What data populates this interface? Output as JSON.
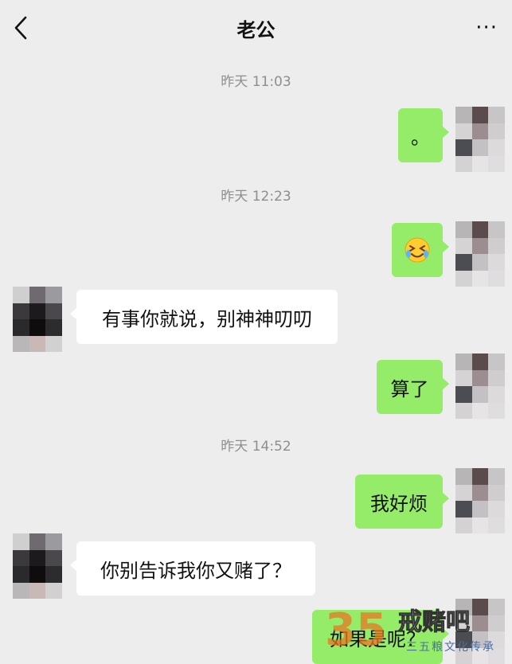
{
  "header": {
    "title": "老公",
    "more": "···"
  },
  "timestamps": [
    "昨天 11:03",
    "昨天 12:23",
    "昨天 14:52"
  ],
  "messages": [
    {
      "from": "me",
      "text": "。"
    },
    {
      "from": "me",
      "text": "😖",
      "emoji": "crying-squint-emoji"
    },
    {
      "from": "other",
      "text": "有事你就说，别神神叨叨"
    },
    {
      "from": "me",
      "text": "算了"
    },
    {
      "from": "me",
      "text": "我好烦"
    },
    {
      "from": "other",
      "text": "你别告诉我你又赌了？"
    },
    {
      "from": "me",
      "text": "如果是呢？"
    }
  ],
  "watermark": {
    "logo_number": "35",
    "name": "戒赌吧",
    "slogan": "三五粮文化传承"
  },
  "colors": {
    "background": "#ededed",
    "my_bubble": "#95ec69",
    "other_bubble": "#ffffff",
    "timestamp": "#8e8e8e"
  }
}
